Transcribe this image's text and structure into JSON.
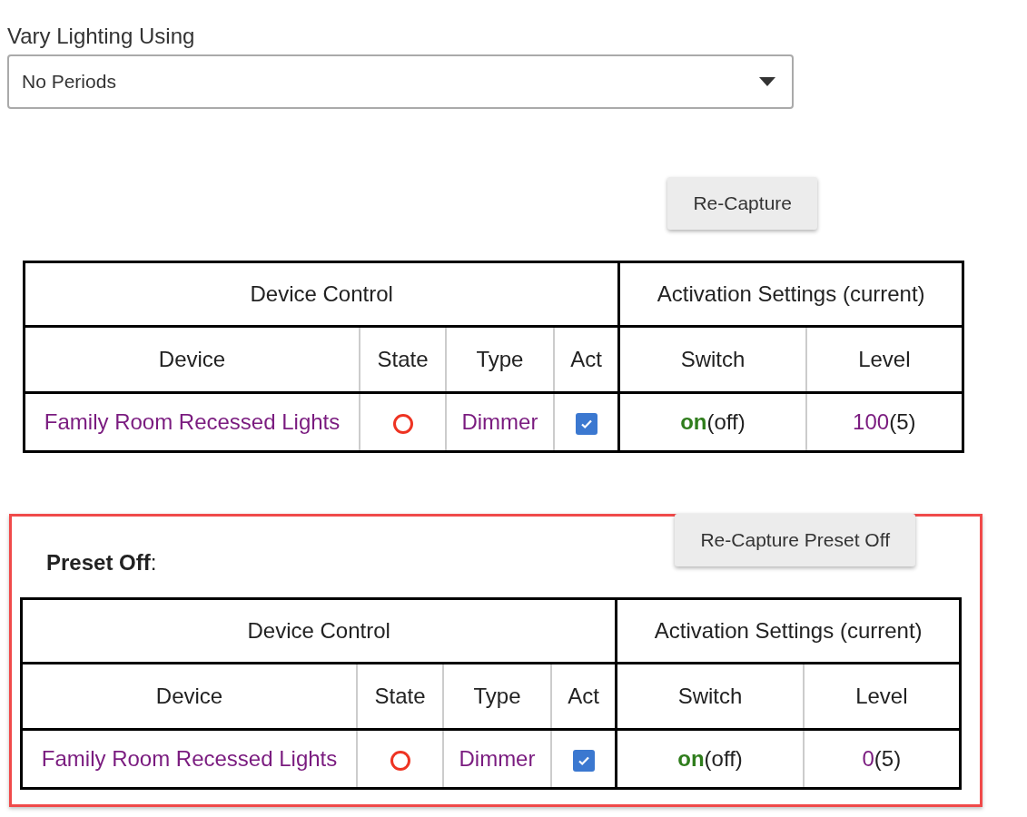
{
  "vary_lighting": {
    "label": "Vary Lighting Using",
    "value": "No Periods"
  },
  "sections": [
    {
      "highlighted": false,
      "button": "Re-Capture",
      "table": {
        "groups": [
          "Device Control",
          "Activation Settings (current)"
        ],
        "columns": [
          "Device",
          "State",
          "Type",
          "Act",
          "Switch",
          "Level"
        ],
        "rows": [
          {
            "device": "Family Room Recessed Lights",
            "on": false,
            "type": "Dimmer",
            "act": true,
            "switch": "on",
            "switch_current": "(off)",
            "level": "100",
            "level_current": "(5)"
          }
        ]
      }
    },
    {
      "title": "Preset Off",
      "title_suffix": ":",
      "highlighted": true,
      "button": "Re-Capture Preset Off",
      "table": {
        "groups": [
          "Device Control",
          "Activation Settings (current)"
        ],
        "columns": [
          "Device",
          "State",
          "Type",
          "Act",
          "Switch",
          "Level"
        ],
        "rows": [
          {
            "device": "Family Room Recessed Lights",
            "on": false,
            "type": "Dimmer",
            "act": true,
            "switch": "on",
            "switch_current": "(off)",
            "level": "0",
            "level_current": "(5)"
          }
        ]
      }
    }
  ]
}
